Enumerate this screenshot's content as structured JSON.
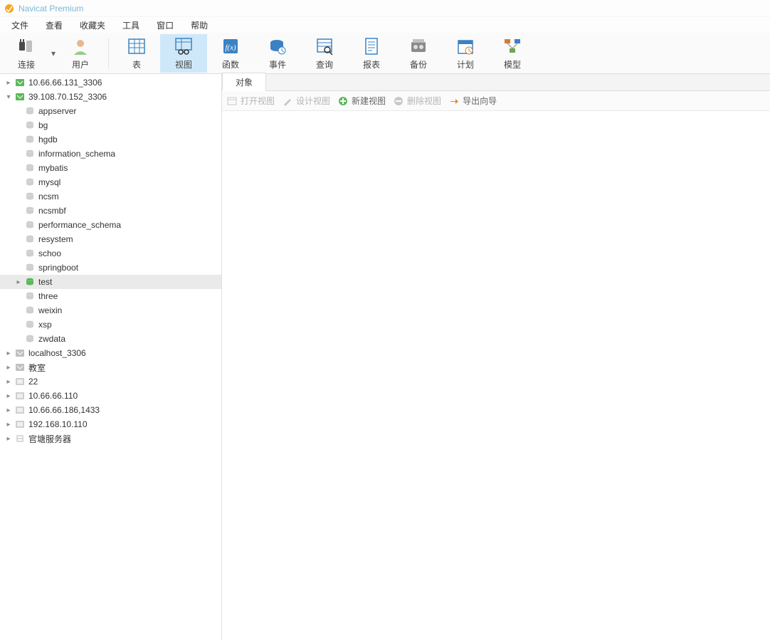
{
  "app": {
    "title": "Navicat Premium"
  },
  "menu": {
    "file": "文件",
    "view": "查看",
    "favorites": "收藏夹",
    "tools": "工具",
    "window": "窗口",
    "help": "帮助"
  },
  "toolbar": {
    "conn": "连接",
    "user": "用户",
    "table": "表",
    "viewbtn": "视图",
    "func": "函数",
    "event": "事件",
    "query": "查询",
    "report": "报表",
    "backup": "备份",
    "plan": "计划",
    "model": "模型"
  },
  "sidebar": {
    "conns": [
      {
        "name": "10.66.66.131_3306",
        "icon": "mysql-conn",
        "expanded": false
      },
      {
        "name": "39.108.70.152_3306",
        "icon": "mysql-conn",
        "expanded": true,
        "databases": [
          "appserver",
          "bg",
          "hgdb",
          "information_schema",
          "mybatis",
          "mysql",
          "ncsm",
          "ncsmbf",
          "performance_schema",
          "resystem",
          "schoo",
          "springboot",
          "test",
          "three",
          "weixin",
          "xsp",
          "zwdata"
        ],
        "selected_db": "test"
      },
      {
        "name": "localhost_3306",
        "icon": "mysql-conn-off"
      },
      {
        "name": "教室",
        "icon": "mysql-conn-off"
      },
      {
        "name": "22",
        "icon": "pg-conn"
      },
      {
        "name": "10.66.66.110",
        "icon": "pg-conn"
      },
      {
        "name": "10.66.66.186,1433",
        "icon": "pg-conn"
      },
      {
        "name": "192.168.10.110",
        "icon": "pg-conn"
      },
      {
        "name": "官塘服务器",
        "icon": "server-conn"
      }
    ]
  },
  "content": {
    "tab0": "对象",
    "viewbar": {
      "open": "打开视图",
      "design": "设计视图",
      "new": "新建视图",
      "delete": "删除视图",
      "export": "导出向导"
    }
  }
}
